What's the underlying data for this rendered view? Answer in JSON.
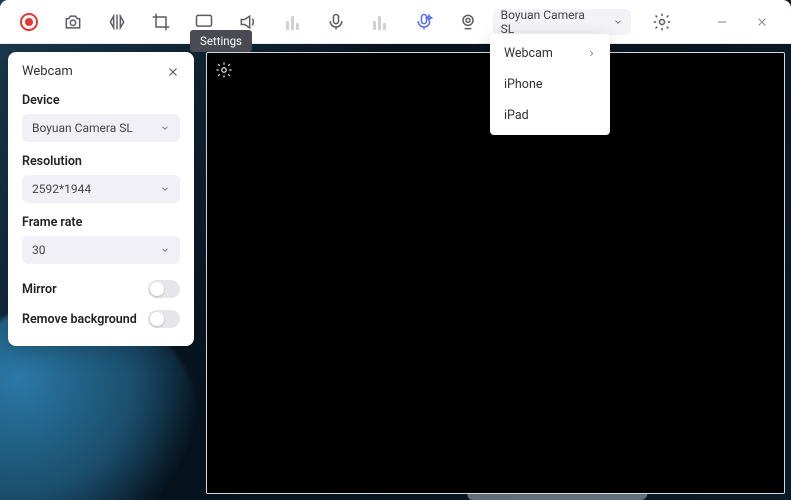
{
  "tooltip": {
    "text": "Settings"
  },
  "toolbar": {
    "camera_selected": "Boyuan Camera SL"
  },
  "camera_menu": {
    "items": [
      {
        "label": "Webcam",
        "has_submenu": true
      },
      {
        "label": "iPhone",
        "has_submenu": false
      },
      {
        "label": "iPad",
        "has_submenu": false
      }
    ]
  },
  "panel": {
    "title": "Webcam",
    "device": {
      "label": "Device",
      "value": "Boyuan Camera SL"
    },
    "resolution": {
      "label": "Resolution",
      "value": "2592*1944"
    },
    "frame_rate": {
      "label": "Frame rate",
      "value": "30"
    },
    "mirror": {
      "label": "Mirror"
    },
    "remove_bg": {
      "label": "Remove background"
    }
  }
}
